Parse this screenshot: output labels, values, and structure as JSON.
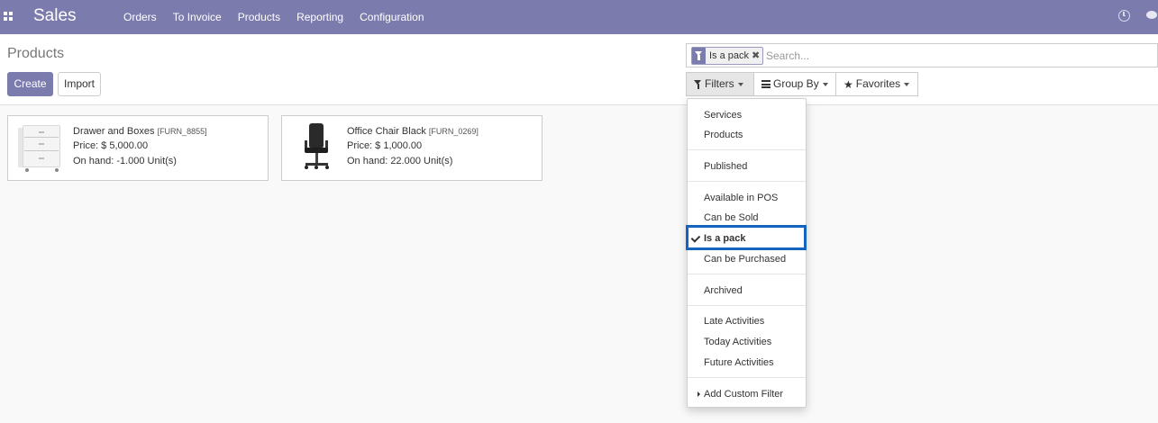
{
  "navbar": {
    "app_name": "Sales",
    "menu": [
      "Orders",
      "To Invoice",
      "Products",
      "Reporting",
      "Configuration"
    ],
    "color": "#7c7bad"
  },
  "control_panel": {
    "title": "Products",
    "create_label": "Create",
    "import_label": "Import"
  },
  "search": {
    "facet_value": "Is a pack",
    "facet_remove": "✖",
    "placeholder": "Search...",
    "value": ""
  },
  "search_buttons": {
    "filters": "Filters",
    "group_by": "Group By",
    "favorites": "Favorites"
  },
  "products": [
    {
      "name": "Drawer and Boxes",
      "code": "[FURN_8855]",
      "price": "Price: $ 5,000.00",
      "on_hand": "On hand: -1.000 Unit(s)",
      "thumbnail_icon": "drawer-cabinet-image"
    },
    {
      "name": "Office Chair Black",
      "code": "[FURN_0269]",
      "price": "Price: $ 1,000.00",
      "on_hand": "On hand: 22.000 Unit(s)",
      "thumbnail_icon": "office-chair-image"
    }
  ],
  "filters_menu": {
    "items": [
      "Services",
      "Products",
      "Published",
      "Available in POS",
      "Can be Sold",
      "Is a pack",
      "Can be Purchased",
      "Archived",
      "Late Activities",
      "Today Activities",
      "Future Activities",
      "Add Custom Filter"
    ],
    "selected": "Is a pack",
    "highlight_color": "#1565c0"
  }
}
